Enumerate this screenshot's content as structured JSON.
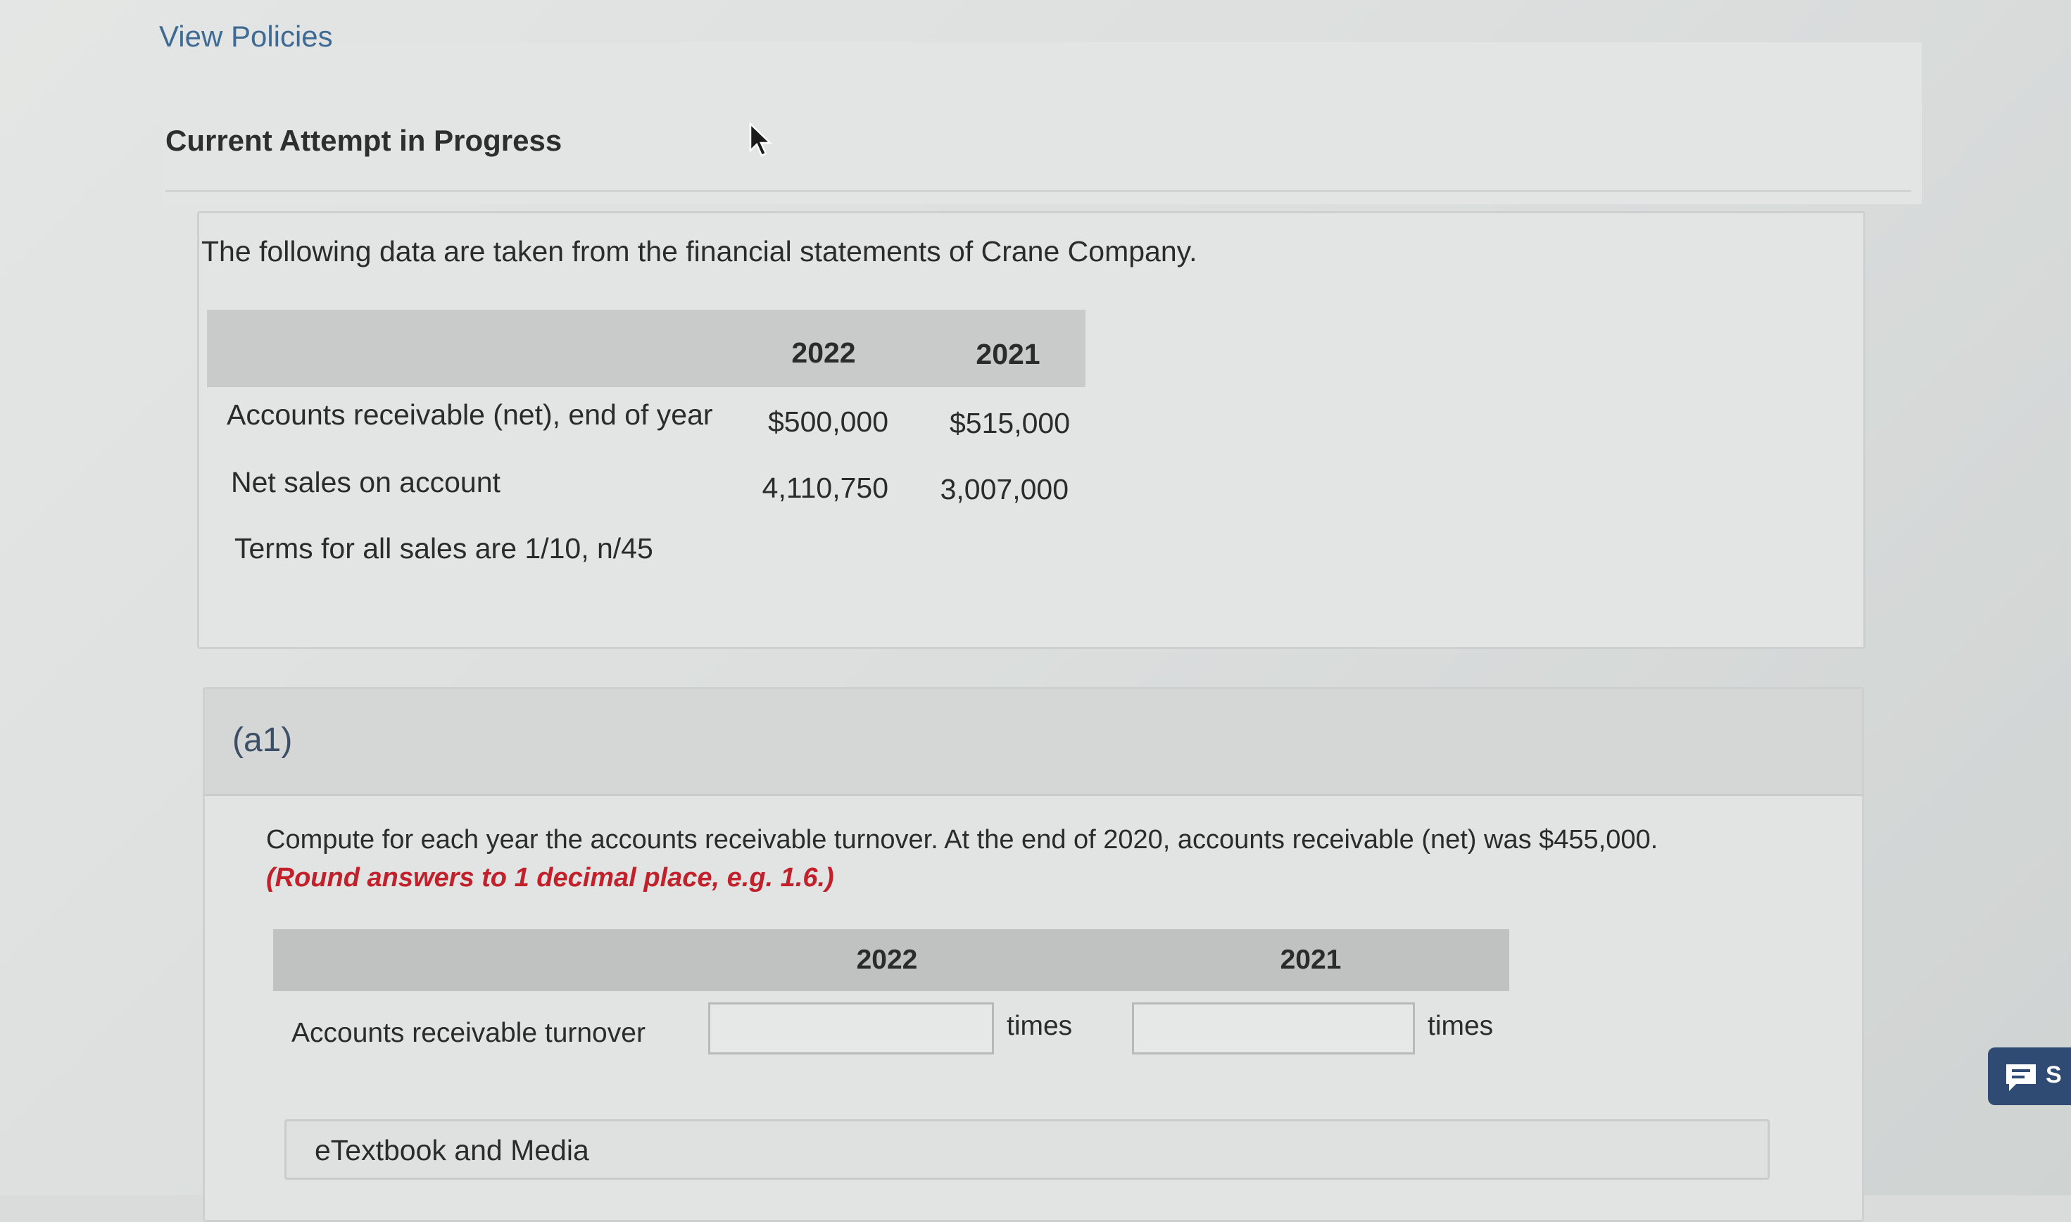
{
  "nav": {
    "view_policies": "View Policies"
  },
  "attempt": {
    "title": "Current Attempt in Progress"
  },
  "problem": {
    "intro": "The following data are taken from the financial statements of Crane Company.",
    "years": [
      "2022",
      "2021"
    ],
    "rows": [
      {
        "label": "Accounts receivable (net), end of year",
        "values": [
          "$500,000",
          "$515,000"
        ]
      },
      {
        "label": "Net sales on account",
        "values": [
          "4,110,750",
          "3,007,000"
        ]
      }
    ],
    "terms": "Terms for all sales are 1/10, n/45"
  },
  "part_a1": {
    "label": "(a1)",
    "question": "Compute for each year the accounts receivable turnover. At the end of 2020, accounts receivable (net) was $455,000.",
    "hint": "(Round answers to 1 decimal place, e.g. 1.6.)",
    "years": [
      "2022",
      "2021"
    ],
    "row_label": "Accounts receivable turnover",
    "inputs": [
      {
        "value": "",
        "unit": "times"
      },
      {
        "value": "",
        "unit": "times"
      }
    ]
  },
  "etextbook": {
    "label": "eTextbook and Media"
  },
  "chat": {
    "label": "S"
  },
  "colors": {
    "link": "#3f6a93",
    "hint": "#c2202a",
    "chat_bg": "#2f4a73"
  },
  "icons": [
    "mouse-cursor-icon",
    "chat-bubble-icon"
  ]
}
